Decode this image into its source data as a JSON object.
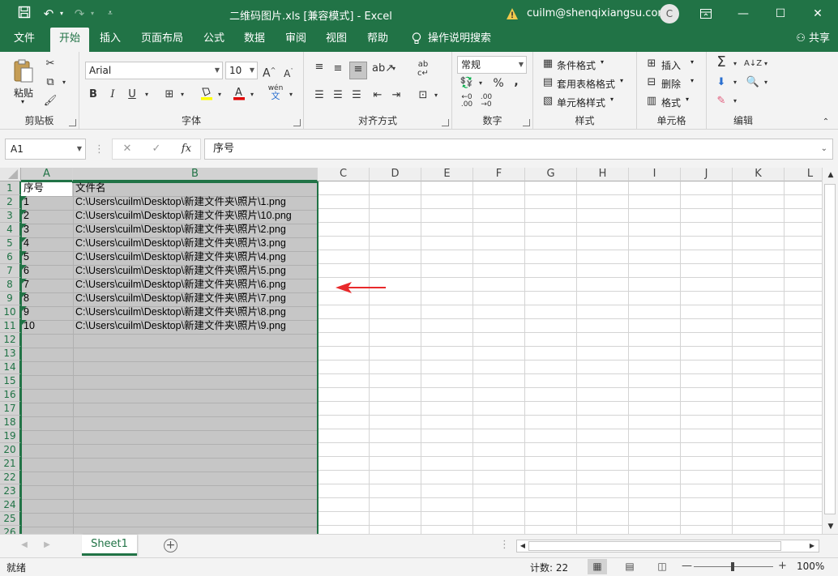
{
  "titlebar": {
    "save_icon": "save-icon",
    "undo_icon": "undo-icon",
    "redo_icon": "redo-icon",
    "customize_icon": "customize-quick-access-icon",
    "doc_title": "二维码图片.xls  [兼容模式]  -  Excel",
    "user_email": "cuilm@shenqixiangsu.com",
    "avatar_initial": "C"
  },
  "tabs": [
    "文件",
    "开始",
    "插入",
    "页面布局",
    "公式",
    "数据",
    "审阅",
    "视图",
    "帮助",
    "操作说明搜索"
  ],
  "active_tab": "开始",
  "share_label": "共享",
  "ribbon": {
    "clipboard": {
      "paste": "粘贴",
      "label": "剪贴板"
    },
    "font": {
      "name": "Arial",
      "size": "10",
      "bold": "B",
      "italic": "I",
      "underline": "U",
      "grow": "A",
      "shrink": "A",
      "label": "字体"
    },
    "alignment": {
      "label": "对齐方式"
    },
    "number": {
      "format": "常规",
      "percent": "%",
      "comma": ",",
      "label": "数字"
    },
    "styles": {
      "conditional": "条件格式",
      "table": "套用表格格式",
      "cell": "单元格样式",
      "label": "样式"
    },
    "cells": {
      "insert": "插入",
      "delete": "删除",
      "format": "格式",
      "label": "单元格"
    },
    "editing": {
      "label": "编辑"
    }
  },
  "formula_bar": {
    "name_box": "A1",
    "formula": "序号"
  },
  "grid": {
    "columns": [
      "A",
      "B",
      "C",
      "D",
      "E",
      "F",
      "G",
      "H",
      "I",
      "J",
      "K",
      "L"
    ],
    "rows": [
      "1",
      "2",
      "3",
      "4",
      "5",
      "6",
      "7",
      "8",
      "9",
      "10",
      "11",
      "12",
      "13",
      "14",
      "15",
      "16",
      "17",
      "18",
      "19",
      "20",
      "21",
      "22",
      "23",
      "24",
      "25",
      "26"
    ],
    "data": [
      [
        "序号",
        "文件名"
      ],
      [
        "1",
        "C:\\Users\\cuilm\\Desktop\\新建文件夹\\照片\\1.png"
      ],
      [
        "2",
        "C:\\Users\\cuilm\\Desktop\\新建文件夹\\照片\\10.png"
      ],
      [
        "3",
        "C:\\Users\\cuilm\\Desktop\\新建文件夹\\照片\\2.png"
      ],
      [
        "4",
        "C:\\Users\\cuilm\\Desktop\\新建文件夹\\照片\\3.png"
      ],
      [
        "5",
        "C:\\Users\\cuilm\\Desktop\\新建文件夹\\照片\\4.png"
      ],
      [
        "6",
        "C:\\Users\\cuilm\\Desktop\\新建文件夹\\照片\\5.png"
      ],
      [
        "7",
        "C:\\Users\\cuilm\\Desktop\\新建文件夹\\照片\\6.png"
      ],
      [
        "8",
        "C:\\Users\\cuilm\\Desktop\\新建文件夹\\照片\\7.png"
      ],
      [
        "9",
        "C:\\Users\\cuilm\\Desktop\\新建文件夹\\照片\\8.png"
      ],
      [
        "10",
        "C:\\Users\\cuilm\\Desktop\\新建文件夹\\照片\\9.png"
      ]
    ]
  },
  "sheets": [
    "Sheet1"
  ],
  "status": {
    "ready": "就绪",
    "count": "计数: 22",
    "zoom": "100%"
  },
  "colors": {
    "accent": "#217346",
    "selection": "#c6c6c6",
    "arrow": "#e8292b"
  }
}
